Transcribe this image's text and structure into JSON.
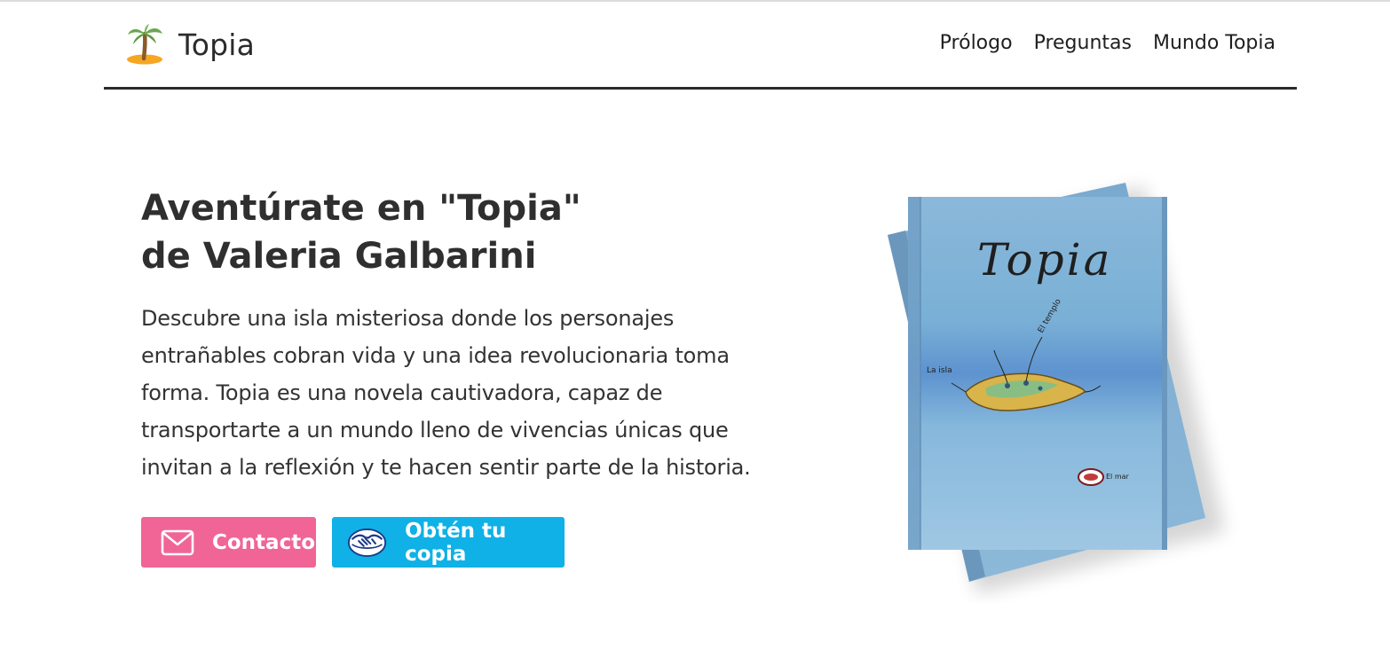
{
  "header": {
    "brand_name": "Topia",
    "brand_icon": "palm-island-icon",
    "nav": [
      {
        "label": "Prólogo"
      },
      {
        "label": "Preguntas"
      },
      {
        "label": "Mundo Topia"
      }
    ]
  },
  "hero": {
    "title": "Aventúrate en \"Topia\" de Valeria Galbarini",
    "description": "Descubre una isla misteriosa donde los personajes entrañables cobran vida y una idea revolucionaria toma forma. Topia es una novela cautivadora, capaz de transportarte a un mundo lleno de vivencias únicas que invitan a la reflexión y te hacen sentir parte de la historia.",
    "buttons": {
      "contact_label": "Contacto",
      "contact_icon": "envelope-icon",
      "buy_label": "Obtén tu copia",
      "buy_icon": "handshake-logo-icon"
    }
  },
  "book": {
    "cover_title": "Topia",
    "map_labels": [
      "La isla",
      "El templo",
      "El mar"
    ]
  },
  "colors": {
    "contact_button": "#f06595",
    "buy_button": "#0fb1e6",
    "text": "#2b2b2b",
    "book_blue": "#7fb2d6"
  }
}
